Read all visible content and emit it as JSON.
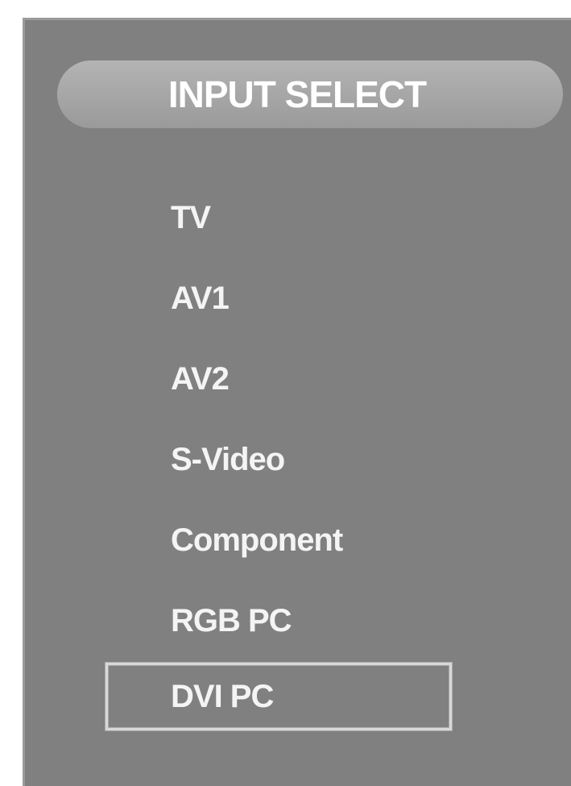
{
  "menu": {
    "title": "INPUT SELECT",
    "items": [
      {
        "label": "TV"
      },
      {
        "label": "AV1"
      },
      {
        "label": "AV2"
      },
      {
        "label": "S-Video"
      },
      {
        "label": "Component"
      },
      {
        "label": "RGB PC"
      },
      {
        "label": "DVI PC",
        "selected": true
      }
    ]
  },
  "colors": {
    "panel_background": "#7f807f",
    "title_bar": "#a6a7a6",
    "text": "#ffffff",
    "selection_border": "#d8d8d8"
  }
}
